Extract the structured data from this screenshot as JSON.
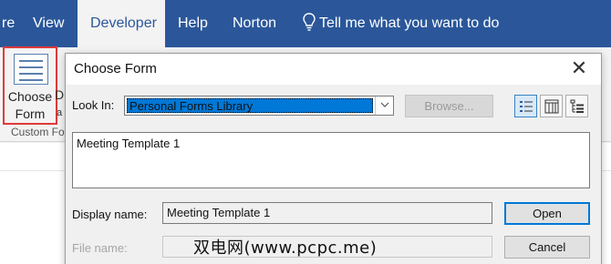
{
  "ribbon": {
    "tabs": [
      "re",
      "View",
      "Developer",
      "Help",
      "Norton"
    ],
    "active_tab": "Developer",
    "tell_me": "Tell me what you want to do",
    "choose_form": {
      "line1": "Choose",
      "line2": "Form"
    },
    "partial_d": "D",
    "partial_a": "a",
    "group_label": "Custom Fo"
  },
  "dialog": {
    "title": "Choose Form",
    "close_glyph": "✕",
    "look_in_label": "Look In:",
    "look_in_value": "Personal Forms Library",
    "browse_label": "Browse...",
    "view_buttons": [
      "details-view-icon",
      "list-view-icon",
      "tree-view-icon"
    ],
    "forms": [
      "Meeting Template 1"
    ],
    "display_name_label": "Display name:",
    "display_name_value": "Meeting Template 1",
    "file_name_label": "File name:",
    "file_name_value": "",
    "open_label": "Open",
    "cancel_label": "Cancel"
  },
  "watermark": "双电网(www.pcpc.me)",
  "colors": {
    "ribbon": "#2b579a",
    "highlight_box": "#e03a3a",
    "selection": "#0078d7"
  }
}
